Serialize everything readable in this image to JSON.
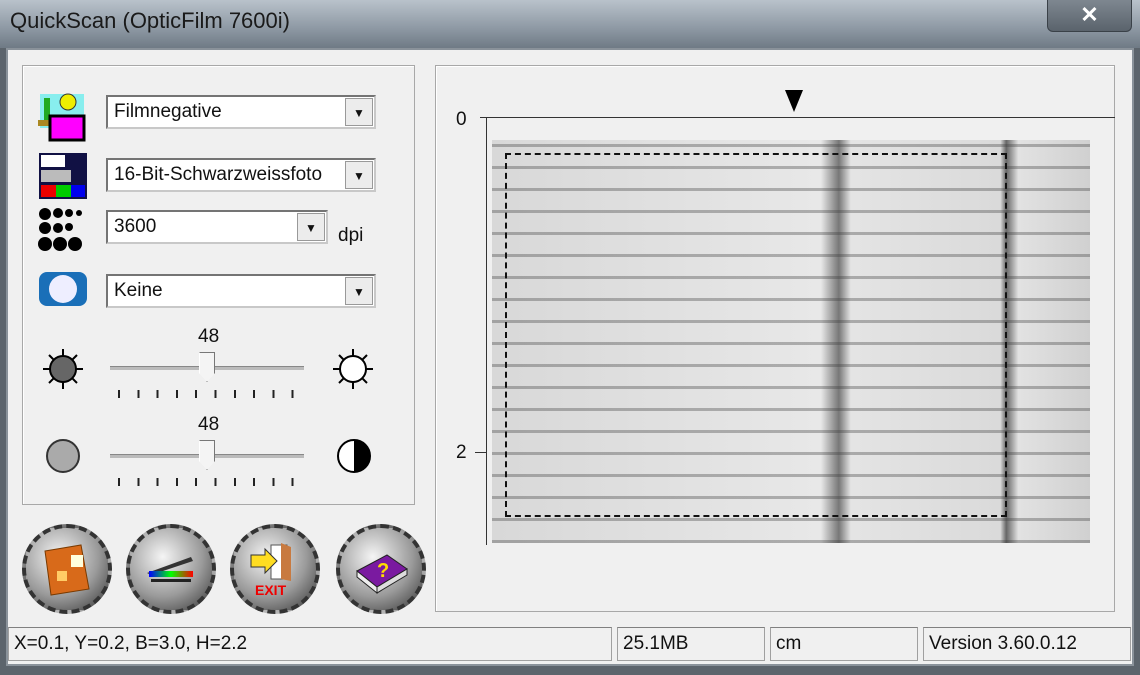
{
  "window": {
    "title": "QuickScan (OpticFilm 7600i)",
    "close_label": "✕"
  },
  "settings": {
    "source": {
      "icon": "film-negative-icon",
      "value": "Filmnegative"
    },
    "mode": {
      "icon": "color-mode-icon",
      "value": "16-Bit-Schwarzweissfoto"
    },
    "resolution": {
      "icon": "resolution-dots-icon",
      "value": "3600",
      "unit": "dpi"
    },
    "filter": {
      "icon": "camera-lens-icon",
      "value": "Keine"
    },
    "brightness": {
      "value": "48",
      "level": 48
    },
    "contrast": {
      "value": "48",
      "level": 48
    }
  },
  "buttons": [
    {
      "name": "scan-to-file",
      "icon": "folder-icon"
    },
    {
      "name": "prescan",
      "icon": "scanner-icon"
    },
    {
      "name": "exit",
      "icon": "exit-door-icon",
      "label": "EXIT"
    },
    {
      "name": "help",
      "icon": "help-book-icon",
      "label": "?"
    }
  ],
  "preview": {
    "ruler_labels": [
      "0",
      "2"
    ]
  },
  "statusbar": {
    "selection": "X=0.1, Y=0.2, B=3.0, H=2.2",
    "size": "25.1MB",
    "unit": "cm",
    "version": "Version 3.60.0.12"
  }
}
